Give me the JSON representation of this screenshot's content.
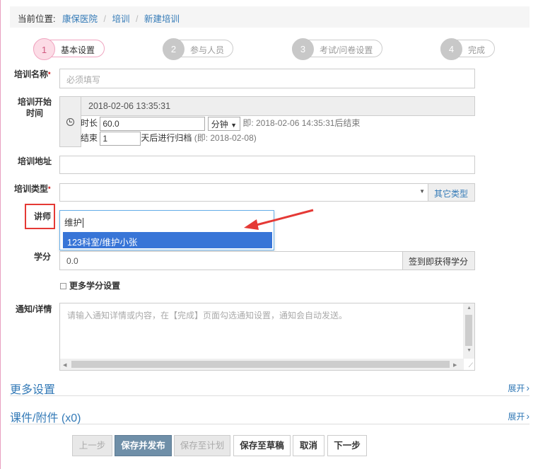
{
  "breadcrumb": {
    "label": "当前位置:",
    "items": [
      "康保医院",
      "培训",
      "新建培训"
    ]
  },
  "steps": [
    {
      "num": "1",
      "label": "基本设置"
    },
    {
      "num": "2",
      "label": "参与人员"
    },
    {
      "num": "3",
      "label": "考试/问卷设置"
    },
    {
      "num": "4",
      "label": "完成"
    }
  ],
  "form": {
    "name_label": "培训名称",
    "name_placeholder": "必须填写",
    "start_label_1": "培训开始",
    "start_label_2": "时间",
    "start_value": "2018-02-06 13:35:31",
    "duration_prefix": "时长",
    "duration_value": "60.0",
    "duration_unit": "分钟",
    "duration_hint": "即: 2018-02-06 14:35:31后结束",
    "end_prefix": "结束",
    "end_value": "1",
    "end_suffix": "天后进行归档",
    "end_hint": "(即: 2018-02-08)",
    "address_label": "培训地址",
    "type_label": "培训类型",
    "type_other_button": "其它类型",
    "teacher_label": "讲师",
    "teacher_typed": "维护",
    "teacher_option": "123科室/维护小张",
    "credit_label": "学分",
    "credit_value": "0.0",
    "credit_button": "签到即获得学分",
    "more_credit_label": "更多学分设置",
    "notice_label": "通知/详情",
    "notice_placeholder": "请输入通知详情或内容，在【完成】页面勾选通知设置，通知会自动发送。",
    "required_mark": "*"
  },
  "sections": {
    "more_settings": "更多设置",
    "attachments": "课件/附件 (x0)",
    "expand": "展开"
  },
  "buttons": {
    "prev": "上一步",
    "save_publish": "保存并发布",
    "save_plan": "保存至计划",
    "save_draft": "保存至草稿",
    "cancel": "取消",
    "next": "下一步"
  },
  "colors": {
    "link": "#337ab7",
    "highlight": "#3875d7",
    "annotation": "#e53935"
  }
}
